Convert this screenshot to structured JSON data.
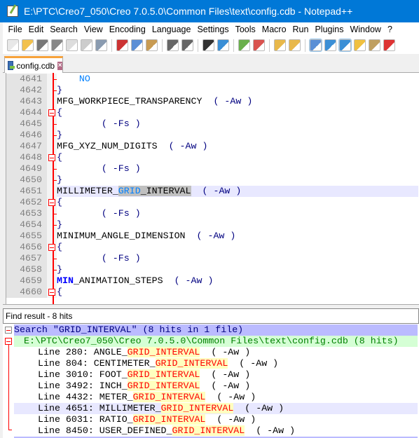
{
  "window": {
    "title": "E:\\PTC\\Creo7_050\\Creo 7.0.5.0\\Common Files\\text\\config.cdb - Notepad++"
  },
  "menu": [
    "File",
    "Edit",
    "Search",
    "View",
    "Encoding",
    "Language",
    "Settings",
    "Tools",
    "Macro",
    "Run",
    "Plugins",
    "Window",
    "?"
  ],
  "toolbar": {
    "icons": [
      "new-file",
      "open-file",
      "save",
      "save-all",
      "close",
      "close-all",
      "print",
      "cut",
      "copy",
      "paste",
      "undo",
      "redo",
      "find",
      "replace",
      "zoom-in",
      "zoom-out",
      "sync-vertical",
      "sync-horizontal",
      "word-wrap",
      "show-all-characters",
      "indent-guide",
      "udl",
      "document-map",
      "function-list"
    ]
  },
  "tab": {
    "label": "config.cdb"
  },
  "editor": {
    "lines": [
      {
        "n": "4641",
        "parts": [
          [
            "kw",
            "    NO"
          ]
        ]
      },
      {
        "n": "4642",
        "parts": [
          [
            "br",
            "}"
          ]
        ]
      },
      {
        "n": "4643",
        "parts": [
          [
            "",
            "MFG_WORKPIECE_TRANSPARENCY  "
          ],
          [
            "br",
            "( -Aw )"
          ]
        ]
      },
      {
        "n": "4644",
        "parts": [
          [
            "br",
            "{"
          ]
        ]
      },
      {
        "n": "4645",
        "parts": [
          [
            "br",
            "        ( -Fs )"
          ]
        ]
      },
      {
        "n": "4646",
        "parts": [
          [
            "br",
            "}"
          ]
        ]
      },
      {
        "n": "4647",
        "parts": [
          [
            "",
            "MFG_XYZ_NUM_DIGITS  "
          ],
          [
            "br",
            "( -Aw )"
          ]
        ]
      },
      {
        "n": "4648",
        "parts": [
          [
            "br",
            "{"
          ]
        ]
      },
      {
        "n": "4649",
        "parts": [
          [
            "br",
            "        ( -Fs )"
          ]
        ]
      },
      {
        "n": "4650",
        "parts": [
          [
            "br",
            "}"
          ]
        ]
      },
      {
        "n": "4651",
        "parts": [
          [
            "",
            "MILLIMETER_"
          ],
          [
            "sel gb",
            "GRID"
          ],
          [
            "sel",
            "_INTERVAL"
          ],
          [
            "",
            "  "
          ],
          [
            "br",
            "( -Aw )"
          ]
        ]
      },
      {
        "n": "4652",
        "parts": [
          [
            "br",
            "{"
          ]
        ]
      },
      {
        "n": "4653",
        "parts": [
          [
            "br",
            "        ( -Fs )"
          ]
        ]
      },
      {
        "n": "4654",
        "parts": [
          [
            "br",
            "}"
          ]
        ]
      },
      {
        "n": "4655",
        "parts": [
          [
            "",
            "MINIMUM_ANGLE_DIMENSION  "
          ],
          [
            "br",
            "( -Aw )"
          ]
        ]
      },
      {
        "n": "4656",
        "parts": [
          [
            "br",
            "{"
          ]
        ]
      },
      {
        "n": "4657",
        "parts": [
          [
            "br",
            "        ( -Fs )"
          ]
        ]
      },
      {
        "n": "4658",
        "parts": [
          [
            "br",
            "}"
          ]
        ]
      },
      {
        "n": "4659",
        "parts": [
          [
            "mn",
            "MIN"
          ],
          [
            "",
            "_ANIMATION_STEPS  "
          ],
          [
            "br",
            "( -Aw )"
          ]
        ]
      },
      {
        "n": "4660",
        "parts": [
          [
            "br",
            "{"
          ]
        ]
      }
    ],
    "current_line": "4651"
  },
  "find_panel": {
    "title": "Find result - 8 hits",
    "search_line": "Search \"GRID_INTERVAL\" (8 hits in 1 file)",
    "file_line": "E:\\PTC\\Creo7_050\\Creo 7.0.5.0\\Common Files\\text\\config.cdb (8 hits)",
    "hits": [
      {
        "prefix": "Line 280: ANGLE_",
        "match": "GRID_INTERVAL",
        "suffix": "  ( -Aw )"
      },
      {
        "prefix": "Line 804: CENTIMETER_",
        "match": "GRID_INTERVAL",
        "suffix": "  ( -Aw )"
      },
      {
        "prefix": "Line 3010: FOOT_",
        "match": "GRID_INTERVAL",
        "suffix": "  ( -Aw )"
      },
      {
        "prefix": "Line 3492: INCH_",
        "match": "GRID_INTERVAL",
        "suffix": "  ( -Aw )"
      },
      {
        "prefix": "Line 4432: METER_",
        "match": "GRID_INTERVAL",
        "suffix": "  ( -Aw )"
      },
      {
        "prefix": "Line 4651: MILLIMETER_",
        "match": "GRID_INTERVAL",
        "suffix": "  ( -Aw )"
      },
      {
        "prefix": "Line 6031: RATIO_",
        "match": "GRID_INTERVAL",
        "suffix": "  ( -Aw )"
      },
      {
        "prefix": "Line 8450: USER_DEFINED_",
        "match": "GRID_INTERVAL",
        "suffix": "  ( -Aw )"
      }
    ],
    "current_hit": 5
  },
  "colors": {
    "titlebar": "#0078d7",
    "fold_marker": "#ff0000",
    "match_text": "#ff0000",
    "match_bg": "#ffffbf",
    "search_header_bg": "#bbbbff",
    "file_header_bg": "#d5ffd5"
  }
}
